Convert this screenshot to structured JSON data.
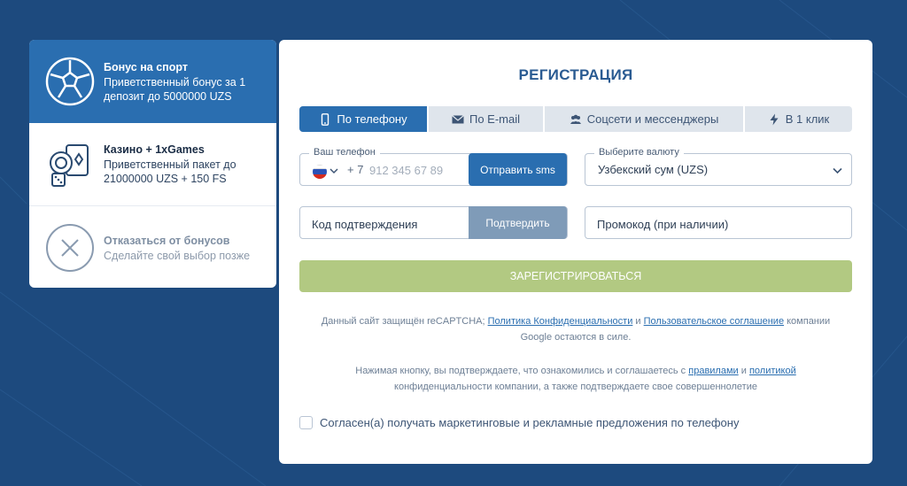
{
  "bonuses": [
    {
      "title": "Бонус на спорт",
      "desc1": "Приветственный бонус за 1",
      "desc2": "депозит до 5000000 UZS",
      "icon": "soccer-ball-icon"
    },
    {
      "title": "Казино + 1xGames",
      "desc1": "Приветственный пакет до",
      "desc2": "21000000 UZS + 150 FS",
      "icon": "casino-chips-icon"
    },
    {
      "title": "Отказаться от бонусов",
      "desc1": "Сделайте свой выбор позже",
      "desc2": "",
      "icon": "close-circle-icon"
    }
  ],
  "registration": {
    "title": "РЕГИСТРАЦИЯ",
    "tabs": [
      {
        "label": "По телефону",
        "icon": "phone-icon"
      },
      {
        "label": "По E-mail",
        "icon": "envelope-icon"
      },
      {
        "label": "Соцсети и мессенджеры",
        "icon": "people-icon"
      },
      {
        "label": "В 1 клик",
        "icon": "lightning-icon"
      }
    ],
    "phone": {
      "label": "Ваш телефон",
      "code": "+ 7",
      "placeholder": "912 345 67 89",
      "send_sms": "Отправить sms"
    },
    "currency": {
      "label": "Выберите валюту",
      "value": "Узбекский сум (UZS)"
    },
    "confirm": {
      "placeholder": "Код подтверждения",
      "button": "Подтвердить"
    },
    "promo": {
      "placeholder": "Промокод (при наличии)"
    },
    "register_button": "ЗАРЕГИСТРИРОВАТЬСЯ",
    "legal1": {
      "pre": "Данный сайт защищён reCAPTCHA; ",
      "link1": "Политика Конфиденциальности",
      "mid": " и ",
      "link2": "Пользовательское соглашение",
      "post": " компании Google остаются в силе."
    },
    "legal2": {
      "pre": "Нажимая кнопку, вы подтверждаете, что ознакомились и соглашаетесь с ",
      "link1": "правилами",
      "mid": " и ",
      "link2": "политикой",
      "post": " конфиденциальности компании, а также подтверждаете свое совершеннолетие"
    },
    "consent": "Согласен(а) получать маркетинговые и рекламные предложения по телефону"
  },
  "colors": {
    "background": "#1d4a7e",
    "primary": "#2a6eb0",
    "register": "#b2c982",
    "confirm": "#7f9bb8"
  }
}
